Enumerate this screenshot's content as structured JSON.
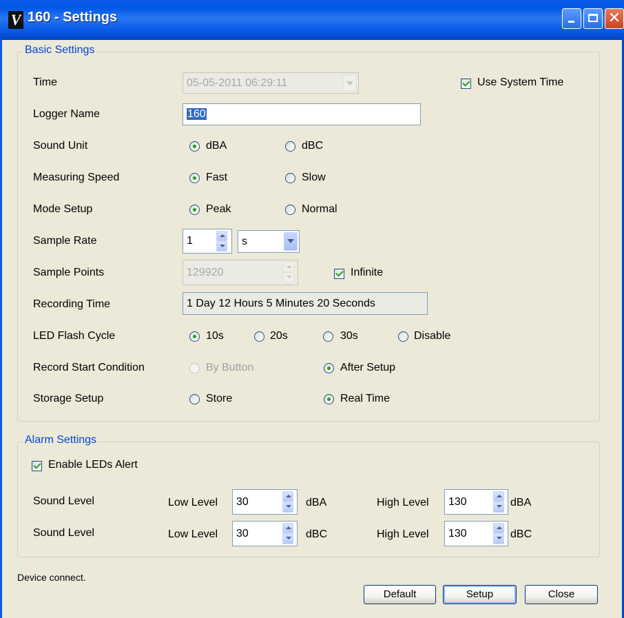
{
  "window": {
    "title": "160 - Settings",
    "logo": "V",
    "close_glyph": "✕"
  },
  "basic": {
    "legend": "Basic Settings",
    "time": {
      "label": "Time",
      "value": "05-05-2011 06:29:11",
      "use_system_time": "Use System Time",
      "use_system_time_checked": true
    },
    "logger_name": {
      "label": "Logger Name",
      "value": "160"
    },
    "sound_unit": {
      "label": "Sound Unit",
      "opt1": "dBA",
      "opt2": "dBC",
      "selected": "dBA"
    },
    "measuring_speed": {
      "label": "Measuring Speed",
      "opt1": "Fast",
      "opt2": "Slow",
      "selected": "Fast"
    },
    "mode_setup": {
      "label": "Mode Setup",
      "opt1": "Peak",
      "opt2": "Normal",
      "selected": "Peak"
    },
    "sample_rate": {
      "label": "Sample Rate",
      "value": "1",
      "unit": "s"
    },
    "sample_points": {
      "label": "Sample Points",
      "value": "129920",
      "infinite": "Infinite",
      "infinite_checked": true
    },
    "recording_time": {
      "label": "Recording Time",
      "value": "1 Day 12 Hours 5 Minutes 20 Seconds"
    },
    "led_flash": {
      "label": "LED Flash Cycle",
      "opt1": "10s",
      "opt2": "20s",
      "opt3": "30s",
      "opt4": "Disable",
      "selected": "10s"
    },
    "record_start": {
      "label": "Record Start Condition",
      "opt1": "By Button",
      "opt2": "After Setup",
      "selected": "After Setup"
    },
    "storage": {
      "label": "Storage Setup",
      "opt1": "Store",
      "opt2": "Real Time",
      "selected": "Real Time"
    }
  },
  "alarm": {
    "legend": "Alarm Settings",
    "enable_leds": "Enable LEDs Alert",
    "enable_leds_checked": true,
    "rows": [
      {
        "label": "Sound Level",
        "low_label": "Low Level",
        "low_value": "30",
        "low_unit": "dBA",
        "high_label": "High Level",
        "high_value": "130",
        "high_unit": "dBA"
      },
      {
        "label": "Sound Level",
        "low_label": "Low Level",
        "low_value": "30",
        "low_unit": "dBC",
        "high_label": "High Level",
        "high_value": "130",
        "high_unit": "dBC"
      }
    ]
  },
  "status": "Device connect.",
  "buttons": {
    "default": "Default",
    "setup": "Setup",
    "close": "Close"
  }
}
